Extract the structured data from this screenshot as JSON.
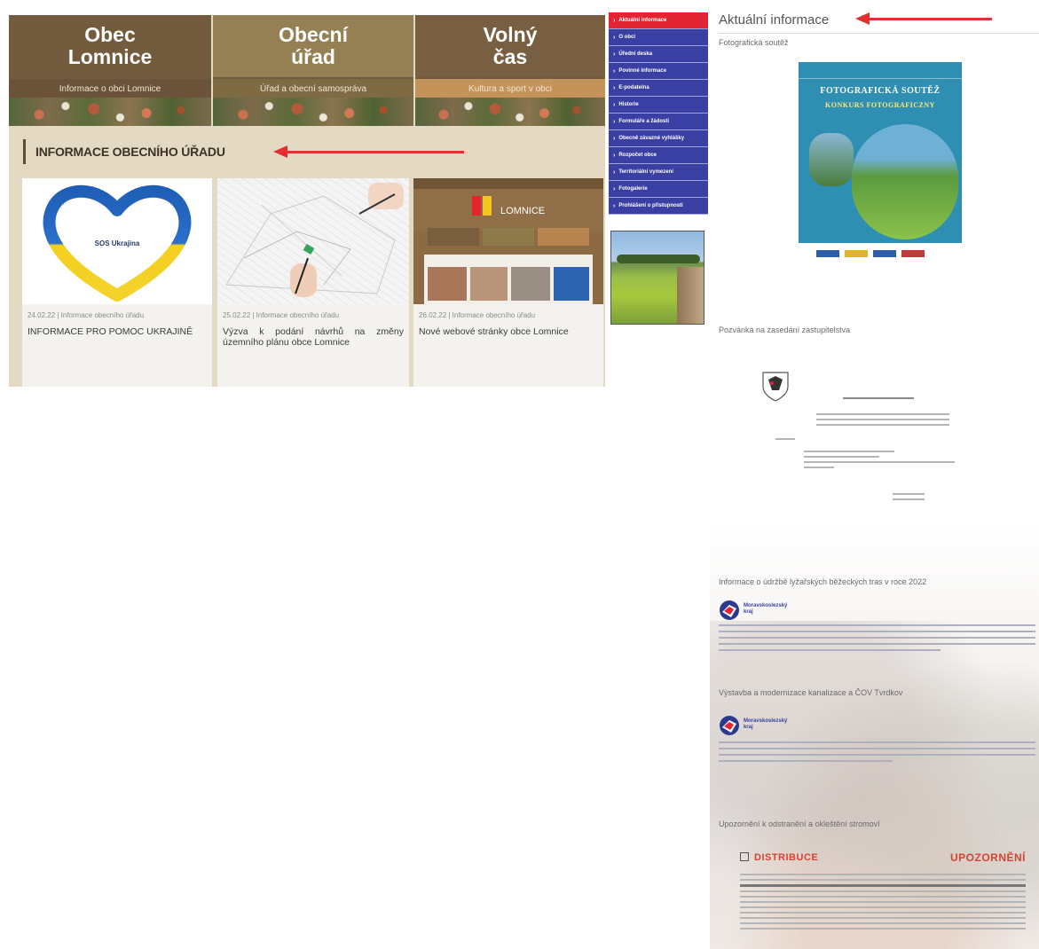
{
  "left_page": {
    "tiles": [
      {
        "title": "Obec\nLomnice",
        "subtitle": "Informace o obci Lomnice"
      },
      {
        "title": "Obecní\núřad",
        "subtitle": "Úřad a obecní samospráva"
      },
      {
        "title": "Volný\nčas",
        "subtitle": "Kultura a sport v obci"
      }
    ],
    "section_title": "INFORMACE OBECNÍHO ÚŘADU",
    "cards": [
      {
        "meta": "24.02.22 | Informace obecního úřadu",
        "title": "INFORMACE PRO POMOC UKRAJINĚ",
        "image_text": "SOS Ukrajina"
      },
      {
        "meta": "25.02.22 | Informace obecního úřadu",
        "title": "Výzva k podání návrhů na změny územního plánu obce Lomnice"
      },
      {
        "meta": "26.02.22 | Informace obecního úřadu",
        "title": "Nové webové stránky obce Lomnice",
        "image_text": "LOMNICE"
      }
    ]
  },
  "nav": {
    "items": [
      {
        "label": "Aktuální informace",
        "active": true
      },
      {
        "label": "O obci"
      },
      {
        "label": "Úřední deska"
      },
      {
        "label": "Povinné informace"
      },
      {
        "label": "E-podatelna"
      },
      {
        "label": "Historie"
      },
      {
        "label": "Formuláře a žádosti"
      },
      {
        "label": "Obecně závazné vyhlášky"
      },
      {
        "label": "Rozpočet obce"
      },
      {
        "label": "Territoriální vymezení"
      },
      {
        "label": "Fotogalerie"
      },
      {
        "label": "Prohlášení o přístupnosti"
      }
    ]
  },
  "right_page": {
    "heading": "Aktuální informace",
    "posts": [
      {
        "title": "Fotografická soutěž"
      },
      {
        "title": "Pozvánka na zasedání zastupitelstva"
      },
      {
        "title": "Informace o údržbě lyžařských běžeckých tras v roce 2022"
      },
      {
        "title": "Výstavba a modernizace kanalizace a ČOV Tvrdkov"
      },
      {
        "title": "Upozornění k odstranění a okleštění stromoví"
      }
    ],
    "poster": {
      "line1": "FOTOGRAFICKÁ SOUTĚŽ",
      "line2": "KONKURS FOTOGRAFICZNY"
    },
    "logo_label": "Moravskoslezský kraj",
    "distribution": {
      "brand": "DISTRIBUCE",
      "warning": "UPOZORNĚNÍ"
    }
  },
  "colors": {
    "arrow": "#e03030",
    "nav_bg": "#3a3fa3",
    "nav_active": "#e22433"
  }
}
